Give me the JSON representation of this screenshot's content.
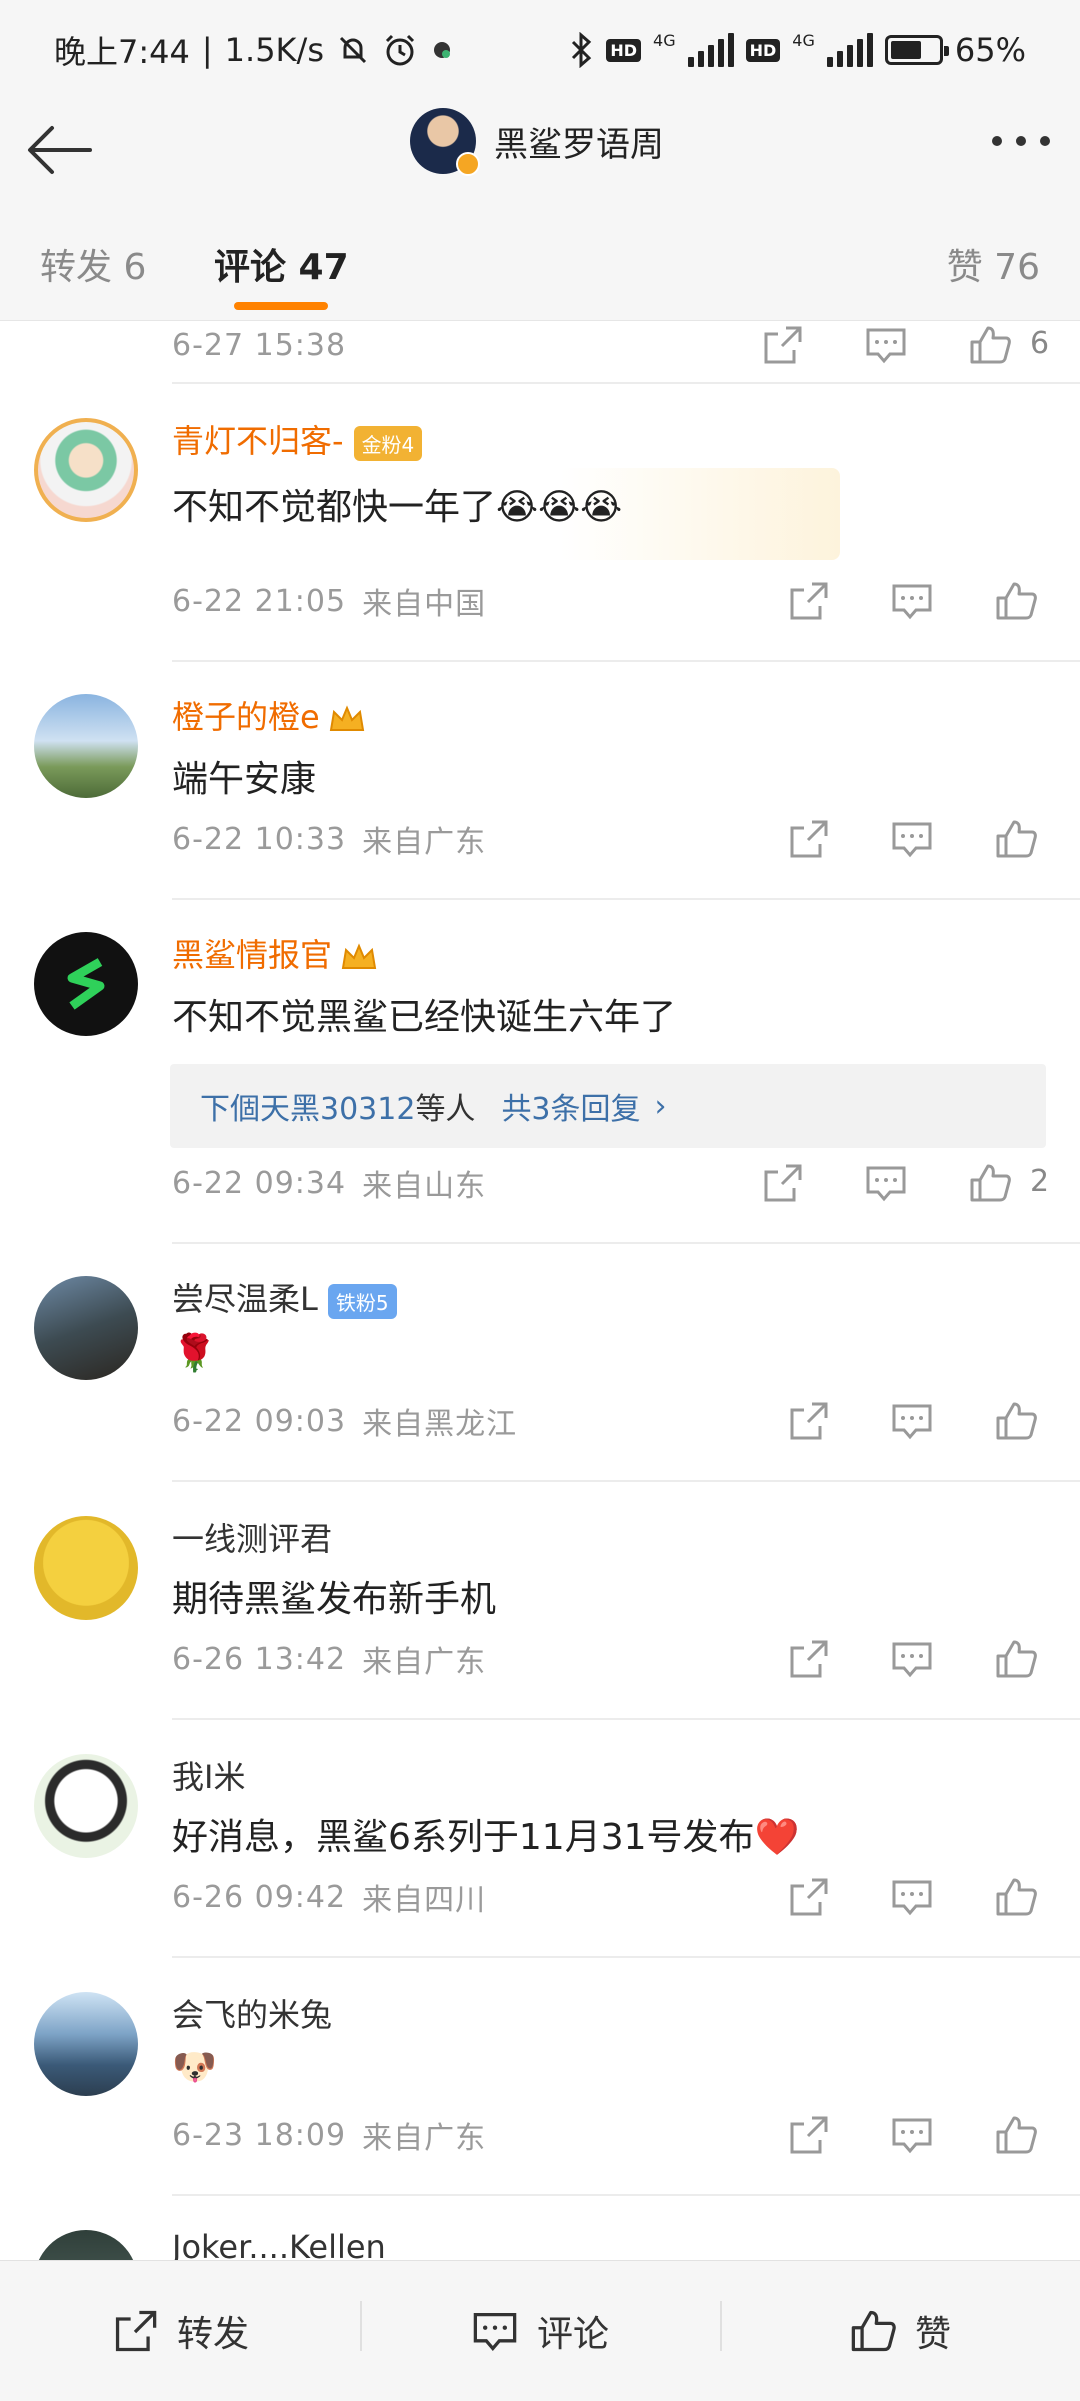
{
  "status_bar": {
    "time": "晚上7:44",
    "speed": "1.5K/s",
    "net1": "4G",
    "net2": "4G",
    "hd": "HD",
    "battery_pct": "65%",
    "battery_level": 0.65
  },
  "nav": {
    "title": "黑鲨罗语周"
  },
  "tabs": {
    "repost": "转发 6",
    "comments": "评论 47",
    "likes": "赞 76",
    "active": "comments"
  },
  "comments": [
    {
      "time": "6-27 15:38",
      "location": "",
      "likes": "6"
    },
    {
      "user": "青灯不归客-",
      "badge": "金粉4",
      "badge_color": "#f2b233",
      "text": "不知不觉都快一年了😭😭😭",
      "time": "6-22 21:05",
      "location": "来自中国",
      "likes": ""
    },
    {
      "user": "橙子的橙e",
      "text": "端午安康",
      "time": "6-22 10:33",
      "location": "来自广东",
      "likes": ""
    },
    {
      "user": "黑鲨情报官",
      "text": "不知不觉黑鲨已经快诞生六年了",
      "reply_user": "下個天黑30312",
      "reply_mid": "等人",
      "reply_total": "共3条回复",
      "reply_arrow": "›",
      "time": "6-22 09:34",
      "location": "来自山东",
      "likes": "2"
    },
    {
      "user": "尝尽温柔L",
      "badge": "铁粉5",
      "badge_color": "#6aa6f0",
      "text": "🌹",
      "time": "6-22 09:03",
      "location": "来自黑龙江",
      "likes": ""
    },
    {
      "user": "一线测评君",
      "text": "期待黑鲨发布新手机",
      "time": "6-26 13:42",
      "location": "来自广东",
      "likes": ""
    },
    {
      "user": "我I米",
      "text": "好消息，黑鲨6系列于11月31号发布❤️",
      "time": "6-26 09:42",
      "location": "来自四川",
      "likes": ""
    },
    {
      "user": "会飞的米兔",
      "text": "🐶",
      "time": "6-23 18:09",
      "location": "来自广东",
      "likes": ""
    },
    {
      "user": "Joker....Kellen"
    }
  ],
  "bottom_bar": {
    "repost": "转发",
    "comment": "评论",
    "like": "赞"
  },
  "colors": {
    "accent": "#ff8200",
    "vip_name": "#f06c00",
    "link": "#3d70a8"
  }
}
